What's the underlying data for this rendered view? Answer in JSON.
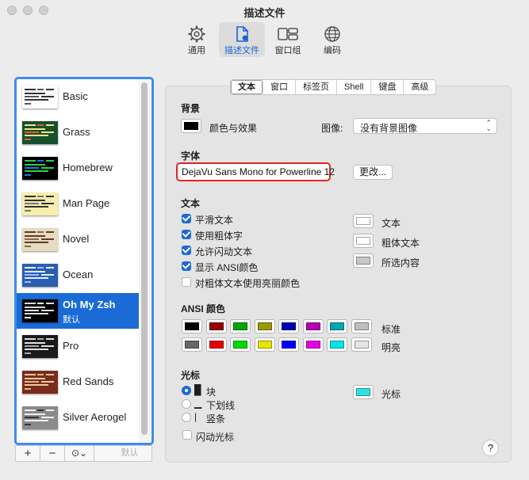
{
  "window": {
    "title": "描述文件"
  },
  "toolbar": [
    {
      "label": "通用",
      "icon": "gear-icon"
    },
    {
      "label": "描述文件",
      "icon": "profile-document-icon",
      "active": true
    },
    {
      "label": "窗口组",
      "icon": "window-group-icon"
    },
    {
      "label": "编码",
      "icon": "globe-icon"
    }
  ],
  "profiles": [
    {
      "name": "Basic",
      "bg": "#ffffff",
      "fg": "#333333",
      "accent": "#555555"
    },
    {
      "name": "Grass",
      "bg": "#15512e",
      "fg": "#f3e28a",
      "accent": "#e85a38"
    },
    {
      "name": "Homebrew",
      "bg": "#000000",
      "fg": "#29d34a",
      "accent": "#2a6df0"
    },
    {
      "name": "Man Page",
      "bg": "#f7eeac",
      "fg": "#333333",
      "accent": "#777777"
    },
    {
      "name": "Novel",
      "bg": "#e6dac0",
      "fg": "#5b3d25",
      "accent": "#8a6a4a"
    },
    {
      "name": "Ocean",
      "bg": "#2a5fb0",
      "fg": "#e8eefc",
      "accent": "#9bc0ff"
    },
    {
      "name": "Oh My Zsh",
      "subtitle": "默认",
      "bg": "#000000",
      "fg": "#dddddd",
      "accent": "#ffffff",
      "selected": true
    },
    {
      "name": "Pro",
      "bg": "#1a1a1a",
      "fg": "#e0e0e0",
      "accent": "#aaaaaa"
    },
    {
      "name": "Red Sands",
      "bg": "#7b2a1e",
      "fg": "#e6cfa3",
      "accent": "#d8c07a"
    },
    {
      "name": "Silver Aerogel",
      "bg": "#8a8a8a",
      "fg": "#f1f1f1",
      "accent": "#333333"
    }
  ],
  "sidebar_footer": {
    "add": "+",
    "remove": "−",
    "more": "⊙⌄",
    "default": "默认"
  },
  "tabs": [
    {
      "label": "文本",
      "active": true
    },
    {
      "label": "窗口"
    },
    {
      "label": "标签页"
    },
    {
      "label": "Shell"
    },
    {
      "label": "键盘"
    },
    {
      "label": "高级"
    }
  ],
  "background": {
    "section": "背景",
    "color_label": "颜色与效果",
    "color": "#000000",
    "image_label": "图像:",
    "image_value": "没有背景图像"
  },
  "font": {
    "section": "字体",
    "value": "DejaVu Sans Mono for Powerline 12",
    "change_button": "更改..."
  },
  "text": {
    "section": "文本",
    "options": [
      {
        "label": "平滑文本",
        "checked": true
      },
      {
        "label": "使用粗体字",
        "checked": true
      },
      {
        "label": "允许闪动文本",
        "checked": true
      },
      {
        "label": "显示 ANSI颜色",
        "checked": true
      },
      {
        "label": "对粗体文本使用亮丽颜色",
        "checked": false
      }
    ],
    "colors": [
      {
        "label": "文本",
        "color": "#ffffff"
      },
      {
        "label": "粗体文本",
        "color": "#ffffff"
      },
      {
        "label": "所选内容",
        "color": "#c8c8c8"
      }
    ]
  },
  "ansi": {
    "section": "ANSI 颜色",
    "normal_label": "标准",
    "bright_label": "明亮",
    "normal": [
      "#000000",
      "#990000",
      "#00a600",
      "#999900",
      "#0000b2",
      "#b200b2",
      "#00a6b2",
      "#bfbfbf"
    ],
    "bright": [
      "#666666",
      "#e50000",
      "#00d900",
      "#e5e500",
      "#0000ff",
      "#e500e5",
      "#00e5e5",
      "#e5e5e5"
    ]
  },
  "cursor": {
    "section": "光标",
    "styles": [
      {
        "glyph": "█",
        "label": "块",
        "selected": true
      },
      {
        "glyph": "▁",
        "label": "下划线",
        "selected": false
      },
      {
        "glyph": "|",
        "label": "竖条",
        "selected": false
      }
    ],
    "blink_label": "闪动光标",
    "blink": false,
    "color_label": "光标",
    "color": "#33e0e0"
  },
  "help": "?"
}
